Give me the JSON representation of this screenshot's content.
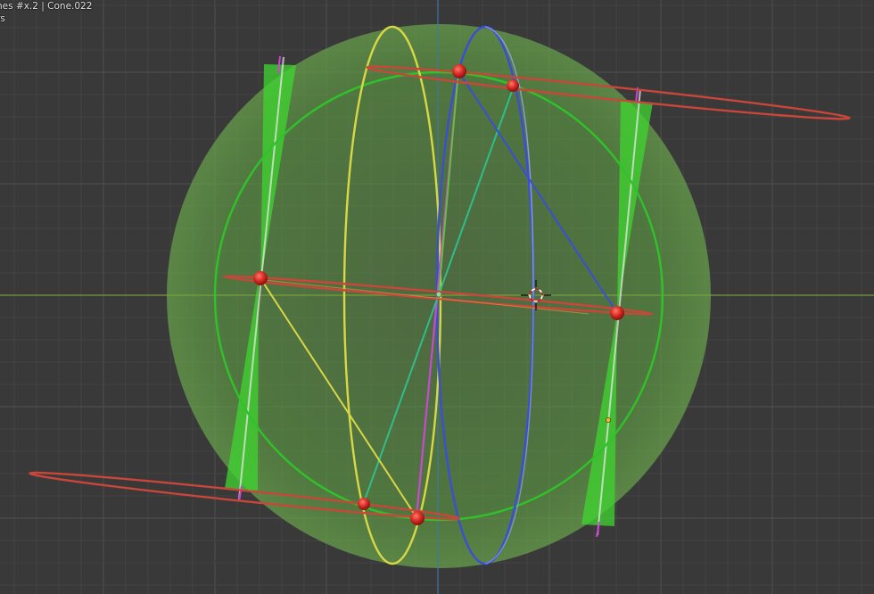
{
  "viewport": {
    "title_line": "nes #x.2 | Cone.022",
    "sub_line": "rs"
  },
  "colors": {
    "background": "#393939",
    "grid_minor": "#444444",
    "grid_major": "#4d4d4d",
    "x_axis": "#7ea53a",
    "z_axis": "#3e6f9c",
    "sphere_fill": "#5c9e3e",
    "green_circle": "#36c22a",
    "yellow_ellipse": "#d7d742",
    "blue_ellipse": "#3a4fd1",
    "red_ring": "#c63c35",
    "magenta_axis": "#c43ac7",
    "green_cone": "#39d12a",
    "node": "#c81e1e"
  },
  "icons": {
    "cursor": "3d-cursor-icon"
  }
}
